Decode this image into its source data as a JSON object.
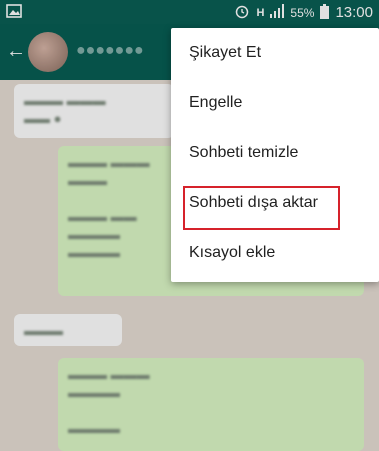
{
  "status_bar": {
    "network_type": "H",
    "battery_percent": "55%",
    "time": "13:00"
  },
  "menu": {
    "items": [
      {
        "label": "Şikayet Et"
      },
      {
        "label": "Engelle"
      },
      {
        "label": "Sohbeti temizle"
      },
      {
        "label": "Sohbeti dışa aktar",
        "highlighted": true
      },
      {
        "label": "Kısayol ekle"
      }
    ]
  },
  "colors": {
    "header": "#075e54",
    "highlight_border": "#d6222b",
    "outgoing_bubble": "#dcf8c6"
  }
}
